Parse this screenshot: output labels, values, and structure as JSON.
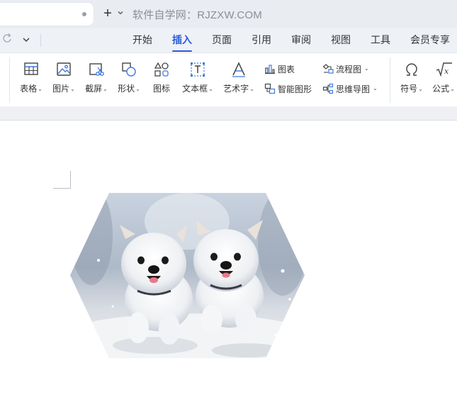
{
  "tabbar": {
    "new_tab": "+",
    "watermark": "软件自学网：RJZXW.COM"
  },
  "menu": {
    "items": [
      "开始",
      "插入",
      "页面",
      "引用",
      "审阅",
      "视图",
      "工具",
      "会员专享"
    ],
    "active": "插入"
  },
  "ribbon": {
    "table": "表格",
    "picture": "图片",
    "screenshot": "截屏",
    "shapes": "形状",
    "icons": "图标",
    "textbox": "文本框",
    "wordart": "艺术字",
    "chart": "图表",
    "smartart": "智能图形",
    "flowchart": "流程图",
    "mindmap": "思维导图",
    "symbol": "符号",
    "formula": "公式"
  },
  "document": {
    "image_subject": "two white puppies running in snow",
    "image_shape": "hexagon"
  },
  "colors": {
    "accent": "#2b5dd9",
    "icon_blue": "#3d7be0",
    "icon_gray": "#444444"
  }
}
